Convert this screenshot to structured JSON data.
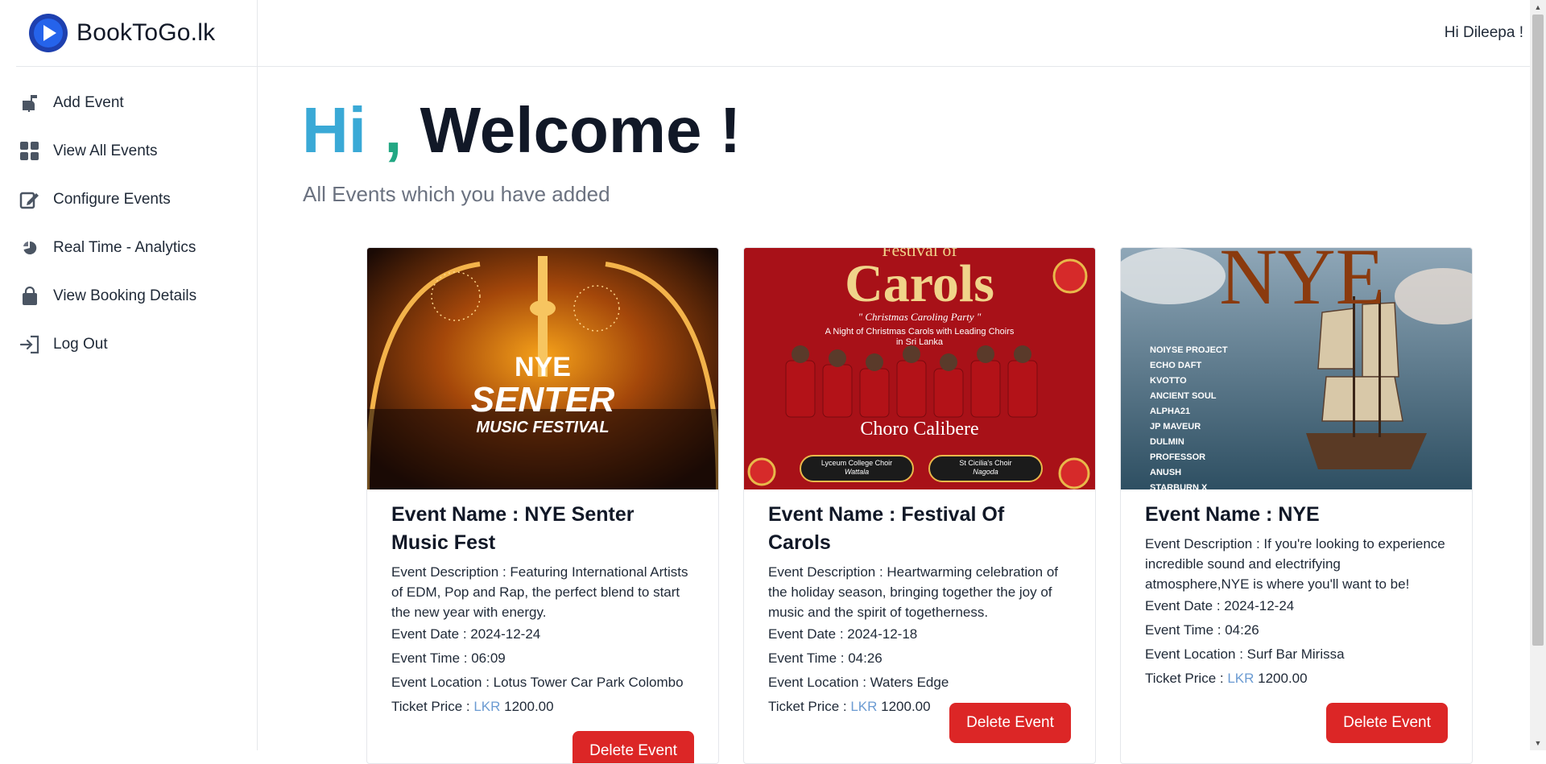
{
  "brand": {
    "name": "BookToGo.lk"
  },
  "header": {
    "greeting": "Hi Dileepa !"
  },
  "sidebar": {
    "items": [
      {
        "label": "Add Event",
        "icon": "mailbox-icon"
      },
      {
        "label": "View All Events",
        "icon": "grid-icon"
      },
      {
        "label": "Configure Events",
        "icon": "edit-icon"
      },
      {
        "label": "Real Time - Analytics",
        "icon": "chart-icon"
      },
      {
        "label": "View Booking Details",
        "icon": "bag-icon"
      },
      {
        "label": "Log Out",
        "icon": "logout-icon"
      }
    ]
  },
  "main": {
    "hero_hi": "Hi",
    "hero_comma": " ,",
    "hero_welcome": " Welcome !",
    "subtitle": "All Events which you have added"
  },
  "events": [
    {
      "title": "Event Name : NYE Senter Music Fest",
      "description": "Event Description : Featuring International Artists of EDM, Pop and Rap, the perfect blend to start the new year with energy.",
      "date": "Event Date : 2024-12-24",
      "time": "Event Time : 06:09",
      "location": "Event Location : Lotus Tower Car Park Colombo",
      "price_label": "Ticket Price : ",
      "currency": "LKR",
      "price": " 1200.00",
      "button": "Delete Event",
      "poster": {
        "line1": "NYE",
        "line2": "SENTER",
        "line3": "MUSIC FESTIVAL"
      }
    },
    {
      "title": "Event Name : Festival Of Carols",
      "description": "Event Description : Heartwarming celebration of the holiday season, bringing together the joy of music and the spirit of togetherness.",
      "date": "Event Date : 2024-12-18",
      "time": "Event Time : 04:26",
      "location": "Event Location : Waters Edge",
      "price_label": "Ticket Price : ",
      "currency": "LKR",
      "price": " 1200.00",
      "button": "Delete Event",
      "poster": {
        "line1": "Festival of",
        "line2": "Carols",
        "line3": "\" Christmas Caroling Party \"",
        "line4": "A Night of Christmas Carols with Leading Choirs",
        "line5": "in Sri Lanka",
        "line6": "Choro Calibere",
        "choir1": "Lyceum College Choir",
        "choir1_loc": "Wattala",
        "choir2": "St Cicilia's Choir",
        "choir2_loc": "Nagoda"
      }
    },
    {
      "title": "Event Name : NYE",
      "description": "Event Description : If you're looking to experience incredible sound and electrifying atmosphere,NYE is where you'll want to be!",
      "date": "Event Date : 2024-12-24",
      "time": "Event Time : 04:26",
      "location": "Event Location : Surf Bar Mirissa",
      "price_label": "Ticket Price : ",
      "currency": "LKR",
      "price": " 1200.00",
      "button": "Delete Event",
      "poster": {
        "line1": "NYE",
        "artists": [
          "NOIYSE PROJECT",
          "ECHO DAFT",
          "KVOTTO",
          "ANCIENT SOUL",
          "ALPHA21",
          "JP MAVEUR",
          "DULMIN",
          "PROFESSOR",
          "ANUSH",
          "STARBURN X"
        ]
      }
    }
  ]
}
